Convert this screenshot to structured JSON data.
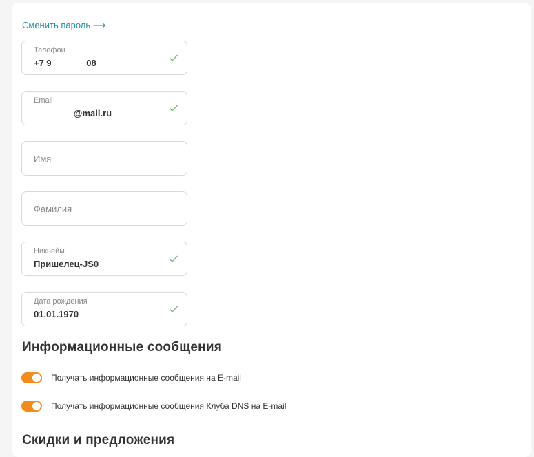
{
  "profile": {
    "change_password_link": "Сменить пароль ⟶",
    "fields": {
      "phone": {
        "label": "Телефон",
        "value": "+7 9              08"
      },
      "email": {
        "label": "Email",
        "value": "                @mail.ru"
      },
      "first_name": {
        "placeholder": "Имя"
      },
      "last_name": {
        "placeholder": "Фамилия"
      },
      "nickname": {
        "label": "Никнейм",
        "value": "Пришелец-JS0"
      },
      "birthday": {
        "label": "Дата рождения",
        "value": "01.01.1970"
      }
    }
  },
  "info_messages": {
    "title": "Информационные сообщения",
    "toggles": [
      {
        "label": "Получать информационные сообщения на E-mail",
        "checked": true
      },
      {
        "label": "Получать информационные сообщения Клуба DNS на E-mail",
        "checked": true
      }
    ]
  },
  "discounts": {
    "title": "Скидки и предложения"
  },
  "colors": {
    "accent_toggle": "#f28c1e",
    "link": "#1f8fa8",
    "check": "#7db87d"
  }
}
